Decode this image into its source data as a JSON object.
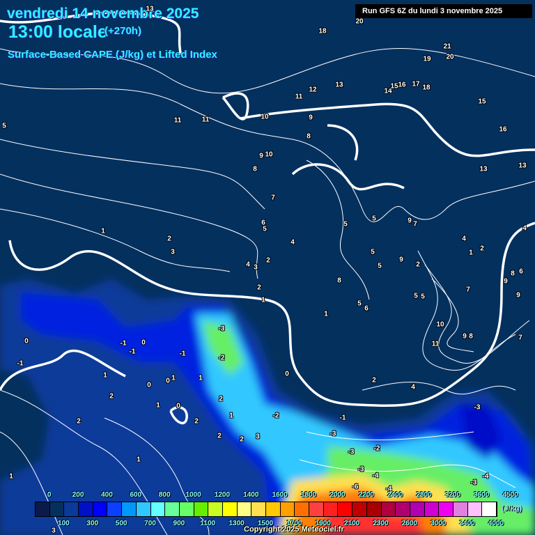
{
  "header": {
    "date": "vendredi 14 novembre 2025",
    "time": "13:00 locale",
    "lead": "(+270h)",
    "parameter": "Surface-Based CAPE (J/kg) et Lifted Index",
    "run": "Run GFS 6Z du lundi 3 novembre 2025"
  },
  "map": {
    "labels": [
      "13",
      "18",
      "20",
      "21",
      "20",
      "19",
      "12",
      "13",
      "11",
      "14",
      "15",
      "16",
      "17",
      "18",
      "15",
      "16",
      "13",
      "13",
      "10",
      "9",
      "8",
      "11",
      "11",
      "5",
      "9",
      "10",
      "8",
      "7",
      "6",
      "5",
      "5",
      "5",
      "9",
      "7",
      "1",
      "2",
      "3",
      "4",
      "3",
      "2",
      "4",
      "5",
      "5",
      "9",
      "2",
      "4",
      "1",
      "2",
      "4",
      "2",
      "8",
      "1",
      "5",
      "6",
      "5",
      "5",
      "7",
      "8",
      "6",
      "9",
      "9",
      "1",
      "10",
      "11",
      "9",
      "8",
      "7",
      "0",
      "-1",
      "0",
      "-3",
      "-1",
      "-1",
      "-1",
      "-2",
      "0",
      "1",
      "0",
      "0",
      "1",
      "1",
      "2",
      "4",
      "2",
      "2",
      "1",
      "0",
      "-3",
      "-2",
      "-1",
      "2",
      "2",
      "1",
      "2",
      "2",
      "3",
      "-3",
      "-2",
      "-3",
      "1",
      "-3",
      "-4",
      "-3",
      "-6",
      "-4",
      "1",
      "-4",
      "3"
    ]
  },
  "legend": {
    "colors": [
      "#0a1a4a",
      "#04305e",
      "#0a3a9a",
      "#0010c8",
      "#0000ff",
      "#0a40ff",
      "#0098ff",
      "#30c8ff",
      "#66ffff",
      "#66ff99",
      "#66ff66",
      "#66ee00",
      "#c8ff20",
      "#ffff00",
      "#ffff88",
      "#ffe050",
      "#ffc800",
      "#ffa000",
      "#ff7000",
      "#ff4040",
      "#ff2020",
      "#ff0000",
      "#c00000",
      "#a80000",
      "#b00040",
      "#b00070",
      "#b000b0",
      "#d000d0",
      "#f000f0",
      "#e080e0",
      "#ffc0ff",
      "#ffffff"
    ],
    "top": [
      "0",
      "200",
      "400",
      "600",
      "800",
      "1000",
      "1200",
      "1400",
      "1600",
      "1800",
      "2000",
      "2200",
      "2400",
      "2800",
      "3200",
      "3600",
      "4500"
    ],
    "bottom": [
      "100",
      "300",
      "500",
      "700",
      "900",
      "1100",
      "1300",
      "1500",
      "1700",
      "1900",
      "2100",
      "2300",
      "2600",
      "3000",
      "3400",
      "4000"
    ],
    "unit": "(J/kg)"
  },
  "copyright": "Copyright 2025 Meteociel.fr"
}
